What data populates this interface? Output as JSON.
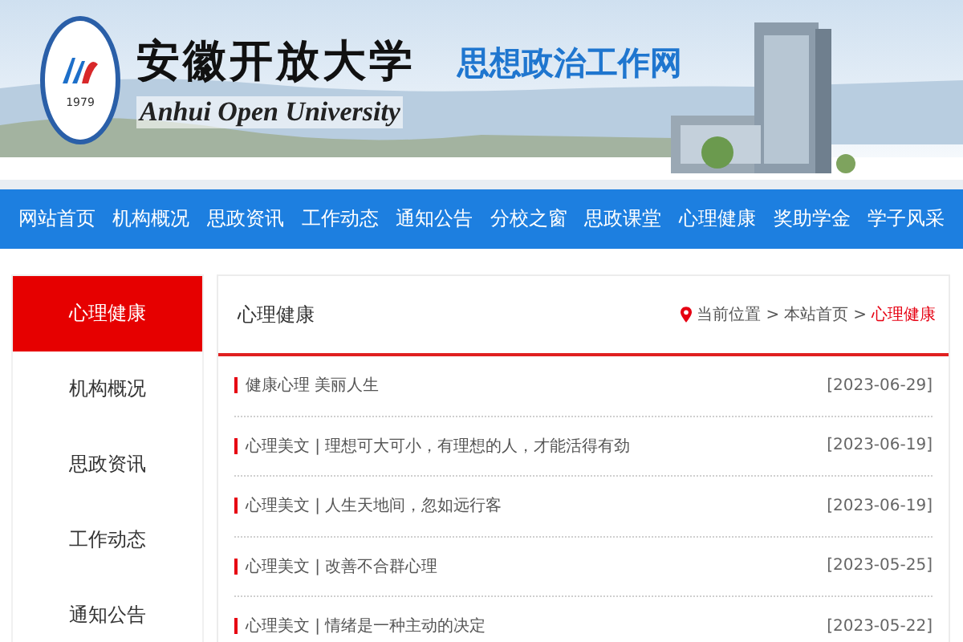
{
  "header": {
    "logo_year": "1979",
    "name_cn": "安徽开放大学",
    "name_en": "Anhui Open University",
    "site_name": "思想政治工作网"
  },
  "nav": [
    {
      "label": "网站首页"
    },
    {
      "label": "机构概况"
    },
    {
      "label": "思政资讯"
    },
    {
      "label": "工作动态"
    },
    {
      "label": "通知公告"
    },
    {
      "label": "分校之窗"
    },
    {
      "label": "思政课堂"
    },
    {
      "label": "心理健康"
    },
    {
      "label": "奖助学金"
    },
    {
      "label": "学子风采"
    }
  ],
  "sidebar": {
    "items": [
      {
        "label": "心理健康",
        "selected": true
      },
      {
        "label": "机构概况",
        "selected": false
      },
      {
        "label": "思政资讯",
        "selected": false
      },
      {
        "label": "工作动态",
        "selected": false
      },
      {
        "label": "通知公告",
        "selected": false
      }
    ]
  },
  "content": {
    "title": "心理健康",
    "breadcrumb": {
      "separator": ">",
      "items": [
        "当前位置",
        "本站首页",
        "心理健康"
      ]
    },
    "articles": [
      {
        "title": "健康心理 美丽人生",
        "date": "[2023-06-29]"
      },
      {
        "title": "心理美文 | 理想可大可小，有理想的人，才能活得有劲",
        "date": "[2023-06-19]"
      },
      {
        "title": "心理美文 | 人生天地间，忽如远行客",
        "date": "[2023-06-19]"
      },
      {
        "title": "心理美文 | 改善不合群心理",
        "date": "[2023-05-25]"
      },
      {
        "title": "心理美文 | 情绪是一种主动的决定",
        "date": "[2023-05-22]"
      }
    ]
  }
}
